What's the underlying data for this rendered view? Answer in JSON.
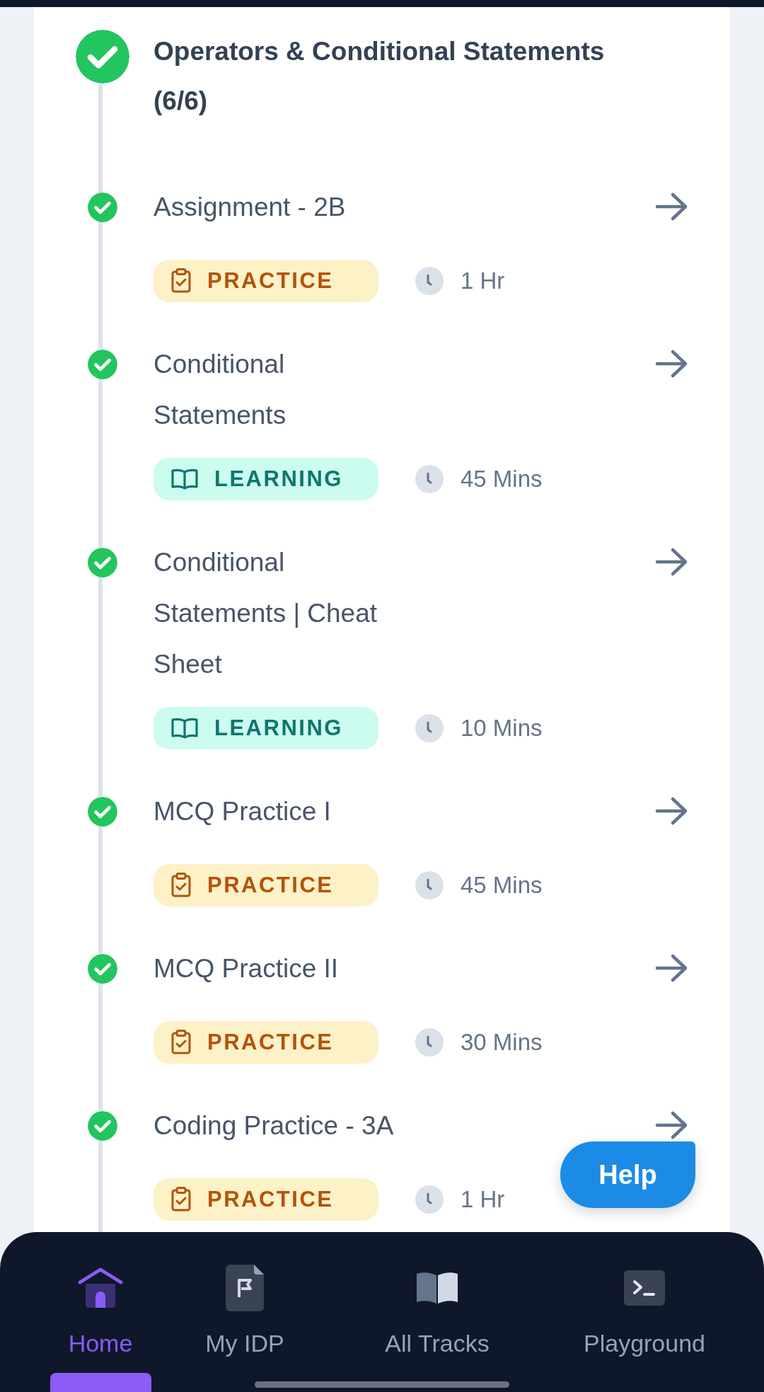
{
  "module": {
    "title": "Operators & Conditional Statements (6/6)",
    "completed": true
  },
  "items": [
    {
      "title": "Assignment - 2B",
      "completed": true,
      "kind": "practice",
      "tag": "PRACTICE",
      "duration": "1 Hr"
    },
    {
      "title": "Conditional Statements",
      "completed": true,
      "kind": "learning",
      "tag": "LEARNING",
      "duration": "45 Mins"
    },
    {
      "title": "Conditional Statements | Cheat Sheet",
      "completed": true,
      "kind": "learning",
      "tag": "LEARNING",
      "duration": "10 Mins"
    },
    {
      "title": "MCQ Practice I",
      "completed": true,
      "kind": "practice",
      "tag": "PRACTICE",
      "duration": "45 Mins"
    },
    {
      "title": "MCQ Practice II",
      "completed": true,
      "kind": "practice",
      "tag": "PRACTICE",
      "duration": "30 Mins"
    },
    {
      "title": "Coding Practice - 3A",
      "completed": true,
      "kind": "practice",
      "tag": "PRACTICE",
      "duration": "1 Hr"
    }
  ],
  "help_button": "Help",
  "nav": [
    {
      "label": "Home",
      "kind": "home",
      "selected": true
    },
    {
      "label": "My IDP",
      "kind": "idp",
      "selected": false
    },
    {
      "label": "All Tracks",
      "kind": "tracks",
      "selected": false
    },
    {
      "label": "Playground",
      "kind": "playground",
      "selected": false
    }
  ]
}
